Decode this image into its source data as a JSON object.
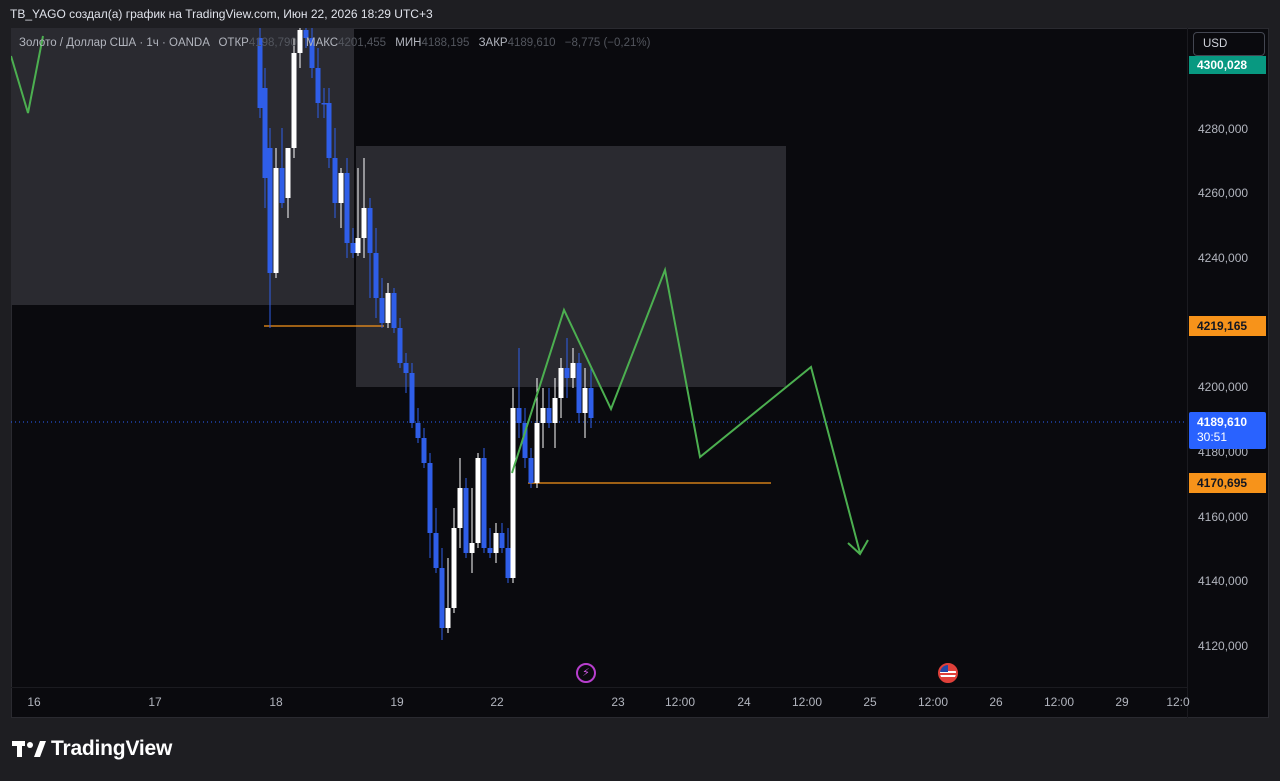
{
  "header": {
    "caption": "TB_YAGO создал(а) график на TradingView.com, Июн 22, 2026 18:29 UTC+3"
  },
  "legend": {
    "symbol": "Золото / Доллар США · 1ч · OANDA",
    "open_label": "ОТКР",
    "open_value": "4198,790",
    "high_label": "МАКС",
    "high_value": "4201,455",
    "low_label": "МИН",
    "low_value": "4188,195",
    "close_label": "ЗАКР",
    "close_value": "4189,610",
    "change": "−8,775 (−0,21%)"
  },
  "currency_button": "USD",
  "price_axis": {
    "labels": [
      "4280,000",
      "4260,000",
      "4240,000",
      "4200,000",
      "4180,000",
      "4160,000",
      "4140,000",
      "4120,000"
    ],
    "tags": {
      "top_green": "4300,028",
      "upper_orange": "4219,165",
      "current_price": "4189,610",
      "countdown": "30:51",
      "lower_orange": "4170,695"
    }
  },
  "time_axis": {
    "labels": [
      "16",
      "17",
      "18",
      "19",
      "22",
      "23",
      "12:00",
      "24",
      "12:00",
      "25",
      "12:00",
      "26",
      "12:00",
      "29",
      "12:0"
    ]
  },
  "colors": {
    "bull": "#ffffff",
    "bear": "#2f5ee8",
    "projection": "#4caf50",
    "level": "#f7931a",
    "zone": "#2a2a30",
    "green_tag": "#089981",
    "price_tag": "#2962ff"
  },
  "events": {
    "lightning_icon": "lightning-icon",
    "flag_icon": "us-flag-icon"
  },
  "brand": {
    "logo_text": "TradingView"
  }
}
